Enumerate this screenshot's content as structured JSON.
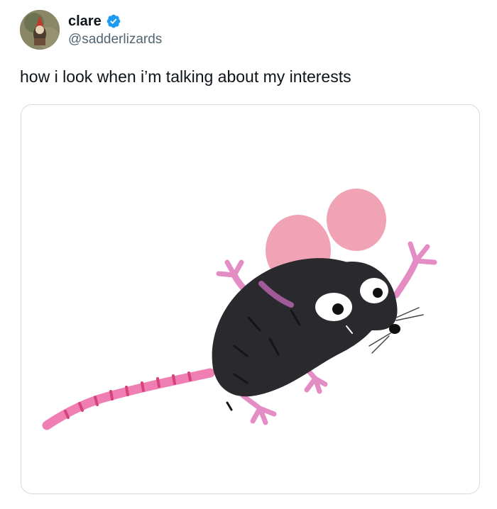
{
  "author": {
    "display_name": "clare",
    "handle": "@sadderlizards",
    "verified": true,
    "verified_color": "#1d9bf0"
  },
  "tweet": {
    "text": "how i look when i’m talking about my interests"
  },
  "media": {
    "description_icon": "mouse-illustration"
  },
  "colors": {
    "text_primary": "#0f1419",
    "text_secondary": "#536471",
    "border": "#d6dbe0",
    "mouse_ear": "#f0a3b4",
    "mouse_limb": "#e48cc4",
    "mouse_body": "#2a2a2e"
  }
}
